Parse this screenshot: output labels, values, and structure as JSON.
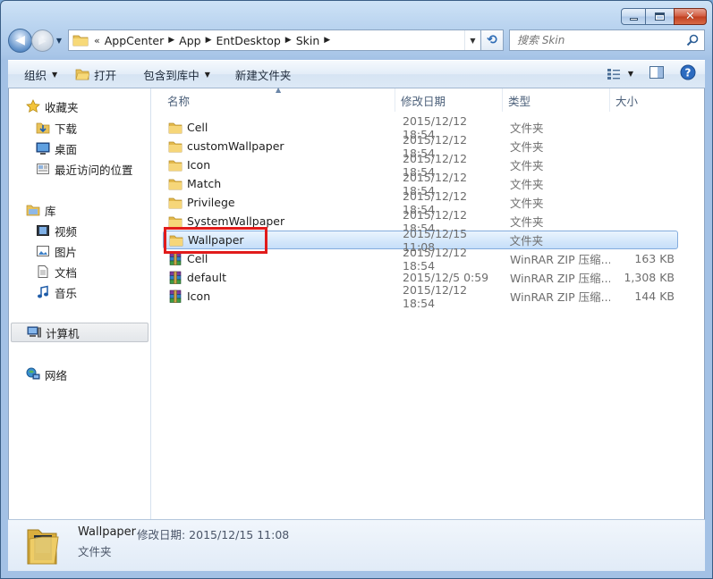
{
  "address": {
    "lead": "«",
    "crumbs": [
      "AppCenter",
      "App",
      "EntDesktop",
      "Skin"
    ]
  },
  "search": {
    "placeholder": "搜索 Skin"
  },
  "toolbar": {
    "organize": "组织",
    "open": "打开",
    "include_library": "包含到库中",
    "new_folder": "新建文件夹"
  },
  "nav": {
    "favorites": "收藏夹",
    "downloads": "下载",
    "desktop": "桌面",
    "recent": "最近访问的位置",
    "libraries": "库",
    "videos": "视频",
    "pictures": "图片",
    "documents": "文档",
    "music": "音乐",
    "computer": "计算机",
    "network": "网络"
  },
  "columns": {
    "name": "名称",
    "date": "修改日期",
    "type": "类型",
    "size": "大小"
  },
  "files": [
    {
      "name": "Cell",
      "date": "2015/12/12 18:54",
      "type": "文件夹",
      "size": "",
      "icon": "folder-icon"
    },
    {
      "name": "customWallpaper",
      "date": "2015/12/12 18:54",
      "type": "文件夹",
      "size": "",
      "icon": "folder-icon"
    },
    {
      "name": "Icon",
      "date": "2015/12/12 18:54",
      "type": "文件夹",
      "size": "",
      "icon": "folder-icon"
    },
    {
      "name": "Match",
      "date": "2015/12/12 18:54",
      "type": "文件夹",
      "size": "",
      "icon": "folder-icon"
    },
    {
      "name": "Privilege",
      "date": "2015/12/12 18:54",
      "type": "文件夹",
      "size": "",
      "icon": "folder-icon"
    },
    {
      "name": "SystemWallpaper",
      "date": "2015/12/12 18:54",
      "type": "文件夹",
      "size": "",
      "icon": "folder-icon"
    },
    {
      "name": "Wallpaper",
      "date": "2015/12/15 11:08",
      "type": "文件夹",
      "size": "",
      "icon": "folder-icon"
    },
    {
      "name": "Cell",
      "date": "2015/12/12 18:54",
      "type": "WinRAR ZIP 压缩...",
      "size": "163 KB",
      "icon": "winrar-zip-icon"
    },
    {
      "name": "default",
      "date": "2015/12/5 0:59",
      "type": "WinRAR ZIP 压缩...",
      "size": "1,308 KB",
      "icon": "winrar-zip-icon"
    },
    {
      "name": "Icon",
      "date": "2015/12/12 18:54",
      "type": "WinRAR ZIP 压缩...",
      "size": "144 KB",
      "icon": "winrar-zip-icon"
    }
  ],
  "selected_index": 6,
  "details": {
    "name": "Wallpaper",
    "date_label": "修改日期: 2015/12/15 11:08",
    "type": "文件夹"
  }
}
